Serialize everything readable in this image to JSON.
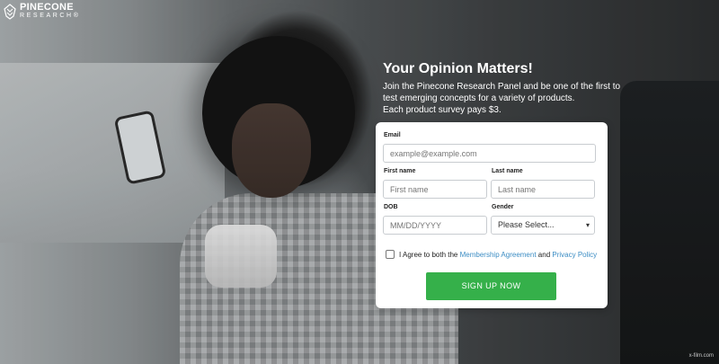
{
  "brand": {
    "name": "PINECONE",
    "subtitle": "RESEARCH",
    "trademark": "®",
    "logo_icon": "pinecone-icon"
  },
  "hero": {
    "title": "Your Opinion Matters!",
    "line1": "Join the Pinecone Research Panel and be one of the first to",
    "line2": "test emerging concepts for a variety of products.",
    "line3": "Each product survey pays $3."
  },
  "form": {
    "email_label": "Email",
    "email_placeholder": "example@example.com",
    "first_name_label": "First name",
    "first_name_placeholder": "First name",
    "last_name_label": "Last name",
    "last_name_placeholder": "Last name",
    "dob_label": "DOB",
    "dob_placeholder": "MM/DD/YYYY",
    "gender_label": "Gender",
    "gender_selected": "Please Select...",
    "agree_prefix": "I Agree to both the",
    "membership_link": "Membership Agreement",
    "and_text": "and",
    "privacy_link": "Privacy Policy",
    "submit_label": "SIGN UP NOW"
  },
  "watermark": "x-film.com",
  "colors": {
    "accent_green": "#35b04a",
    "link_blue": "#3c8dc4",
    "card_bg": "#ffffff"
  }
}
